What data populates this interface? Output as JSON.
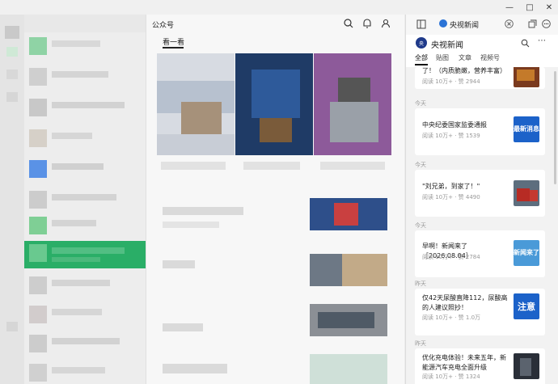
{
  "window": {
    "minimize": "—",
    "maximize": "□",
    "close": "✕"
  },
  "official_accounts": {
    "title": "公众号",
    "tab_label": "看一看"
  },
  "side_panel": {
    "tab_title": "央视新闻",
    "account_name": "央视新闻",
    "avatar_text": "央",
    "tabs": [
      {
        "label": "全部",
        "active": true
      },
      {
        "label": "贴图",
        "active": false
      },
      {
        "label": "文章",
        "active": false
      },
      {
        "label": "视频号",
        "active": false
      }
    ],
    "articles": [
      {
        "date": "",
        "title": "了！（内质脆嫩，营养丰富）",
        "meta": "阅读 10万+ · 赞 2944",
        "thumb_text": ""
      },
      {
        "date": "今天",
        "title": "中央纪委国家监委通报",
        "meta": "阅读 10万+ · 赞 1539",
        "thumb_text": "最新消息"
      },
      {
        "date": "今天",
        "title": "\"刘兄弟，到家了！\"",
        "meta": "阅读 10万+ · 赞 4490",
        "thumb_text": ""
      },
      {
        "date": "今天",
        "title": "早啊！新闻来了［2026.08.04］",
        "meta": "阅读 10万+ · 赞 2784",
        "thumb_text": "新闻来了"
      },
      {
        "date": "昨天",
        "title": "仅42天尿酸直降112，尿酸高的人建议照抄！",
        "meta": "阅读 10万+ · 赞 1.0万",
        "thumb_text": "注意"
      },
      {
        "date": "昨天",
        "title": "优化充电体验！未来五年，新能源汽车充电全面升级",
        "meta": "阅读 10万+ · 赞 1324",
        "thumb_text": ""
      }
    ]
  },
  "colors": {
    "accent_green": "#2aae67",
    "cctv_blue": "#1c62c9"
  }
}
